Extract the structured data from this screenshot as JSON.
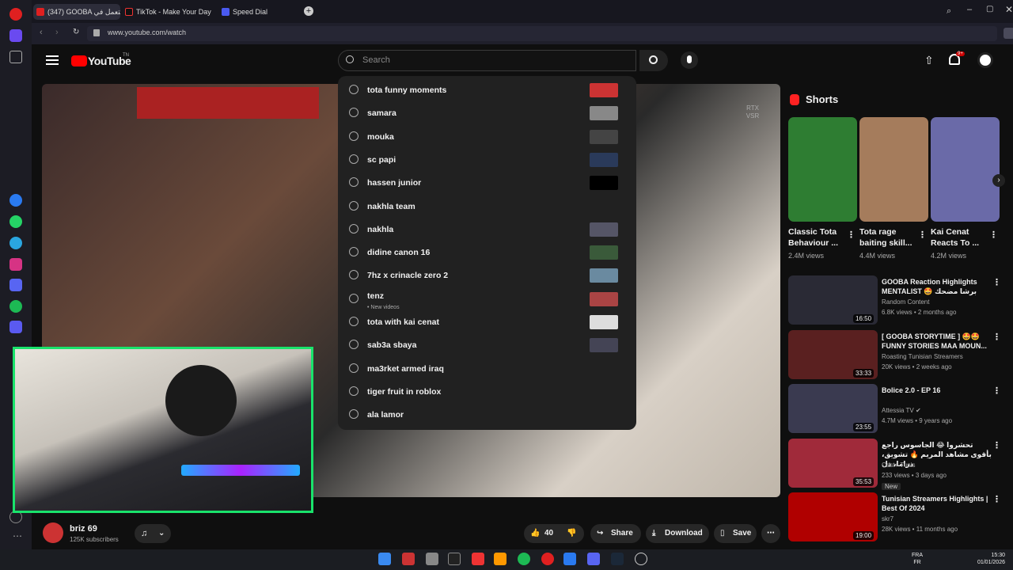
{
  "tabs": [
    {
      "label": "(347) GOOBA استعمل في",
      "color": "#e02020"
    },
    {
      "label": "TikTok - Make Your Day",
      "color": "#111"
    },
    {
      "label": "Speed Dial",
      "color": "#4a5af0"
    }
  ],
  "url": "www.youtube.com/watch",
  "yt_logo": "YouTube",
  "yt_region": "TN",
  "search_placeholder": "Search",
  "notif_badge": "9+",
  "video_overlay": "RTX VSR",
  "suggestions": [
    {
      "text": "tota funny moments",
      "thumb": "#c33"
    },
    {
      "text": "samara",
      "thumb": "#888"
    },
    {
      "text": "mouka",
      "thumb": "#444"
    },
    {
      "text": "sc papi",
      "thumb": "#2a3a5a"
    },
    {
      "text": "hassen junior",
      "thumb": "#000"
    },
    {
      "text": "nakhla team",
      "thumb": ""
    },
    {
      "text": "nakhla",
      "thumb": "#556"
    },
    {
      "text": "didine canon 16",
      "thumb": "#3a5a3a"
    },
    {
      "text": "7hz x crinacle zero 2",
      "thumb": "#6a8aa0"
    },
    {
      "text": "tenz",
      "thumb": "#a44",
      "sub": "• New videos"
    },
    {
      "text": "tota with kai cenat",
      "thumb": "#ddd"
    },
    {
      "text": "sab3a sbaya",
      "thumb": "#445"
    },
    {
      "text": "ma3rket armed iraq",
      "thumb": ""
    },
    {
      "text": "tiger fruit in roblox",
      "thumb": ""
    },
    {
      "text": "ala lamor",
      "thumb": ""
    }
  ],
  "shorts": {
    "heading": "Shorts",
    "items": [
      {
        "title": "Classic Tota Behaviour ...",
        "views": "2.4M views",
        "color": "#2e7d32"
      },
      {
        "title": "Tota rage baiting skill...",
        "views": "4.4M views",
        "color": "#a57c5c"
      },
      {
        "title": "Kai Cenat Reacts To ...",
        "views": "4.2M views",
        "color": "#6a6aa8"
      }
    ]
  },
  "recommended": [
    {
      "title": "GOOBA Reaction Highlights MENTALIST 🤩 برشا مضحك",
      "channel": "Random Content",
      "meta": "6.8K views • 2 months ago",
      "duration": "16:50",
      "color": "#2a2a35"
    },
    {
      "title": "[ GOOBA STORYTIME ] 🤩🤩 FUNNY STORIES MAA MOUN...",
      "channel": "Roasting Tunisian Streamers",
      "meta": "20K views • 2 weeks ago",
      "duration": "33:33",
      "color": "#5a2020"
    },
    {
      "title": "Bolice 2.0 - EP 16",
      "channel": "Attessia TV ✔",
      "meta": "4.7M views • 9 years ago",
      "duration": "23:55",
      "color": "#3a3a50"
    },
    {
      "title": "تحشروا 😂 الجاسوس راجع بأقوى مشاهد المريم 🔥 تشويق، دراما، ذل",
      "channel": "Cast+ Tunis",
      "meta": "233 views • 3 days ago",
      "badge": "New",
      "duration": "35:53",
      "color": "#a02a3a"
    },
    {
      "title": "Tunisian Streamers Highlights | Best Of 2024",
      "channel": "skr7",
      "meta": "28K views • 11 months ago",
      "duration": "19:00",
      "color": "#b00000"
    }
  ],
  "channel": {
    "name": "briz 69",
    "subs": "125K subscribers"
  },
  "actions": {
    "likes": "40",
    "share": "Share",
    "download": "Download",
    "save": "Save"
  },
  "clock": {
    "time": "15:30",
    "date": "01/01/2026",
    "lang": "FRA",
    "lang2": "FR"
  }
}
